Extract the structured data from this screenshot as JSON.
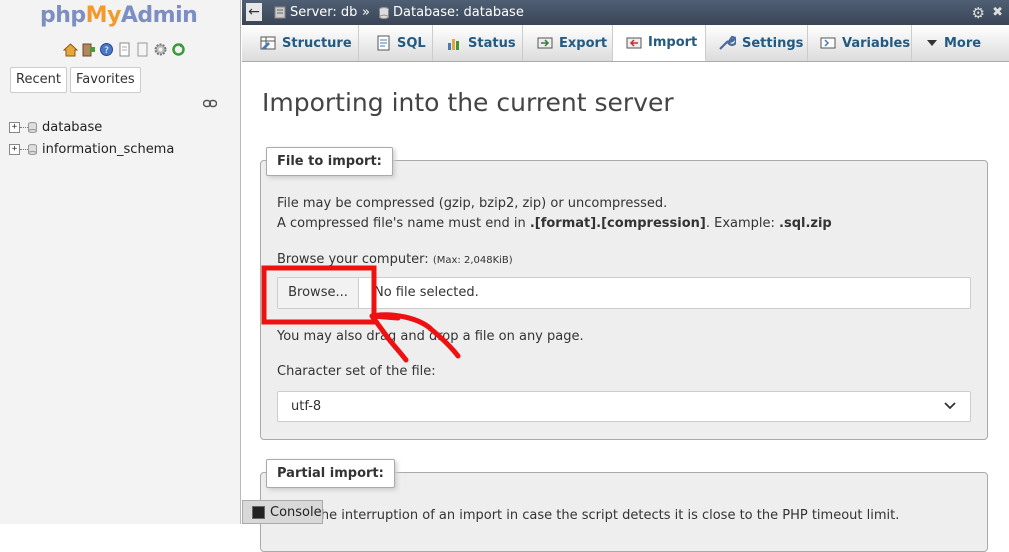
{
  "logo": {
    "part1": "php",
    "part2": "My",
    "part3": "Admin"
  },
  "nav": {
    "recent_label": "Recent",
    "favorites_label": "Favorites",
    "databases": [
      {
        "name": "database",
        "expander": "+"
      },
      {
        "name": "information_schema",
        "expander": "+"
      }
    ]
  },
  "breadcrumb": {
    "server": "Server: db",
    "separator": "»",
    "database": "Database: database"
  },
  "tabs": [
    {
      "label": "Structure",
      "icon": "structure-icon"
    },
    {
      "label": "SQL",
      "icon": "sql-icon"
    },
    {
      "label": "Status",
      "icon": "status-icon"
    },
    {
      "label": "Export",
      "icon": "export-icon"
    },
    {
      "label": "Import",
      "icon": "import-icon",
      "active": true
    },
    {
      "label": "Settings",
      "icon": "wrench-icon"
    },
    {
      "label": "Variables",
      "icon": "variables-icon"
    },
    {
      "label": "More",
      "icon": "caret-down-icon"
    }
  ],
  "main": {
    "title": "Importing into the current server",
    "file_section": {
      "legend": "File to import:",
      "line1": "File may be compressed (gzip, bzip2, zip) or uncompressed.",
      "line2_pre": "A compressed file's name must end in ",
      "line2_bold1": ".[format].[compression]",
      "line2_mid": ". Example: ",
      "line2_bold2": ".sql.zip",
      "browse_label": "Browse your computer:",
      "browse_max": "(Max: 2,048KiB)",
      "browse_button": "Browse...",
      "file_status": "No file selected.",
      "drag_text": "You may also drag and drop a file on any page.",
      "charset_label": "Character set of the file:",
      "charset_value": "utf-8"
    },
    "partial_section": {
      "legend": "Partial import:",
      "line1": "Allow the interruption of an import in case the script detects it is close to the PHP timeout limit."
    }
  },
  "console": {
    "label": "Console"
  },
  "colors": {
    "annotation_red": "#ee1111",
    "link_blue": "#235a81",
    "topbar": "#4f5f74"
  }
}
